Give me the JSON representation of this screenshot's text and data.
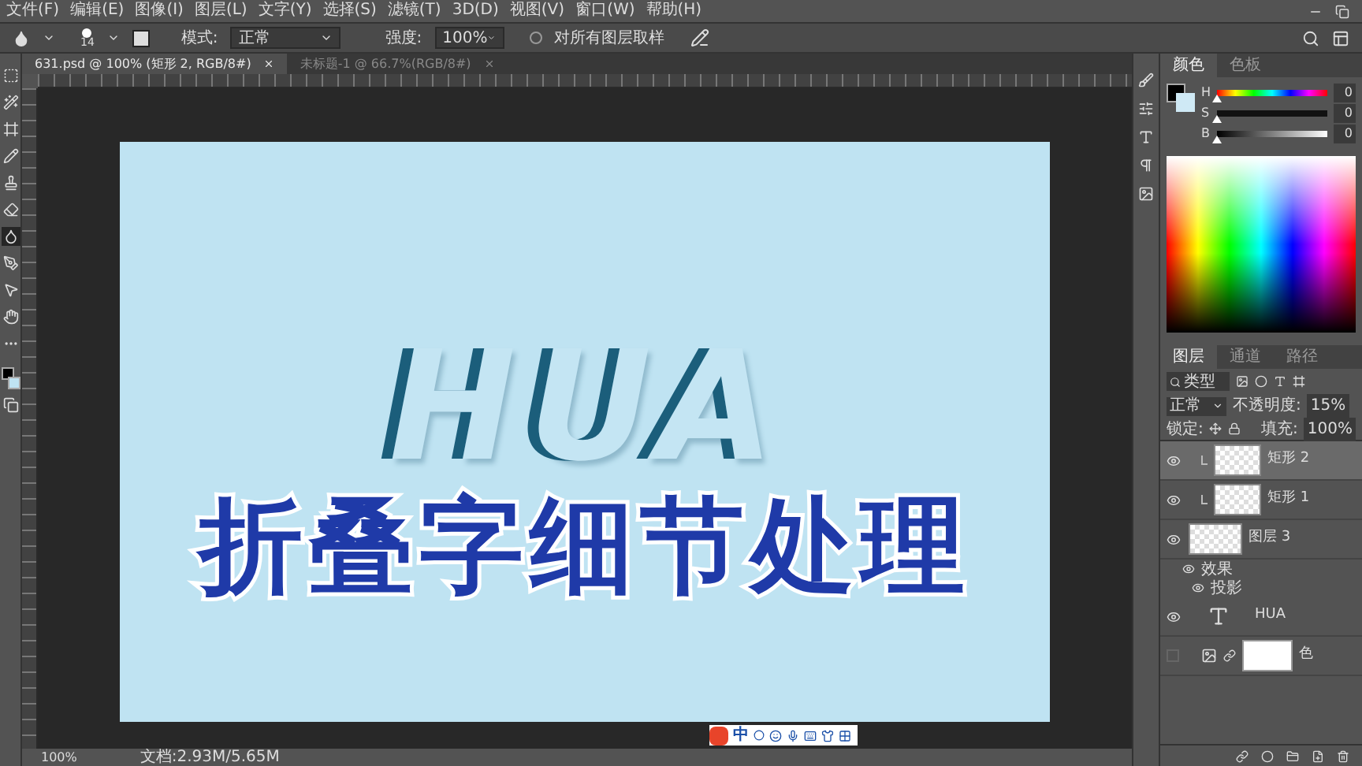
{
  "menu": [
    "文件(F)",
    "编辑(E)",
    "图像(I)",
    "图层(L)",
    "文字(Y)",
    "选择(S)",
    "滤镜(T)",
    "3D(D)",
    "视图(V)",
    "窗口(W)",
    "帮助(H)"
  ],
  "options": {
    "brush_size": "14",
    "mode_label": "模式:",
    "mode": "正常",
    "strength_label": "强度:",
    "strength": "100%",
    "sample_all": {
      "label": "对所有图层取样",
      "checked": false
    }
  },
  "tabs": [
    {
      "label": "631.psd @ 100% (矩形 2, RGB/8#)",
      "selected": true
    },
    {
      "label": "未标题-1 @ 66.7%(RGB/8#)",
      "selected": false
    }
  ],
  "tools": [
    {
      "kind": "marquee",
      "selected": false
    },
    {
      "kind": "wand",
      "selected": false
    },
    {
      "kind": "frame",
      "selected": false
    },
    {
      "kind": "pencil",
      "selected": false
    },
    {
      "kind": "stamp",
      "selected": false
    },
    {
      "kind": "eraser",
      "selected": false
    },
    {
      "kind": "drop",
      "selected": true
    },
    {
      "kind": "pen",
      "selected": false
    },
    {
      "kind": "pointer",
      "selected": false
    },
    {
      "kind": "hand",
      "selected": false
    },
    {
      "kind": "more",
      "selected": false
    }
  ],
  "canvas": {
    "title": "HUA",
    "subtitle": "折叠字细节处理"
  },
  "ime": {
    "label": "中"
  },
  "color_panel": {
    "tabs": [
      {
        "label": "颜色",
        "selected": true
      },
      {
        "label": "色板",
        "selected": false
      }
    ],
    "sliders": [
      {
        "label": "H",
        "kind": "hue",
        "level": 0,
        "value": "0"
      },
      {
        "label": "S",
        "kind": "saturation",
        "level": 0,
        "value": "0"
      },
      {
        "label": "B",
        "kind": "brightness",
        "level": 0,
        "value": "0"
      }
    ]
  },
  "layers_panel": {
    "tabs": [
      {
        "label": "图层",
        "selected": true
      },
      {
        "label": "通道",
        "selected": false
      },
      {
        "label": "路径",
        "selected": false
      }
    ],
    "filter": "类型",
    "blend": "正常",
    "opacity_label": "不透明度:",
    "opacity": "15%",
    "lock_label": "锁定:",
    "fill_label": "填充:",
    "fill": "100%",
    "layers": [
      {
        "kind": "clipped",
        "name": "矩形 2",
        "visible": true,
        "selected": true
      },
      {
        "kind": "clipped",
        "name": "矩形 1",
        "visible": true,
        "selected": false
      },
      {
        "kind": "pixel",
        "name": "图层 3",
        "visible": true,
        "selected": false,
        "effects": [
          "效果",
          "投影"
        ]
      },
      {
        "kind": "text",
        "name": "HUA",
        "visible": true,
        "selected": false
      },
      {
        "kind": "fill",
        "name": "色",
        "visible": false,
        "selected": false
      }
    ]
  },
  "status": {
    "zoom": "100%",
    "doc": "文档:2.93M/5.65M"
  }
}
